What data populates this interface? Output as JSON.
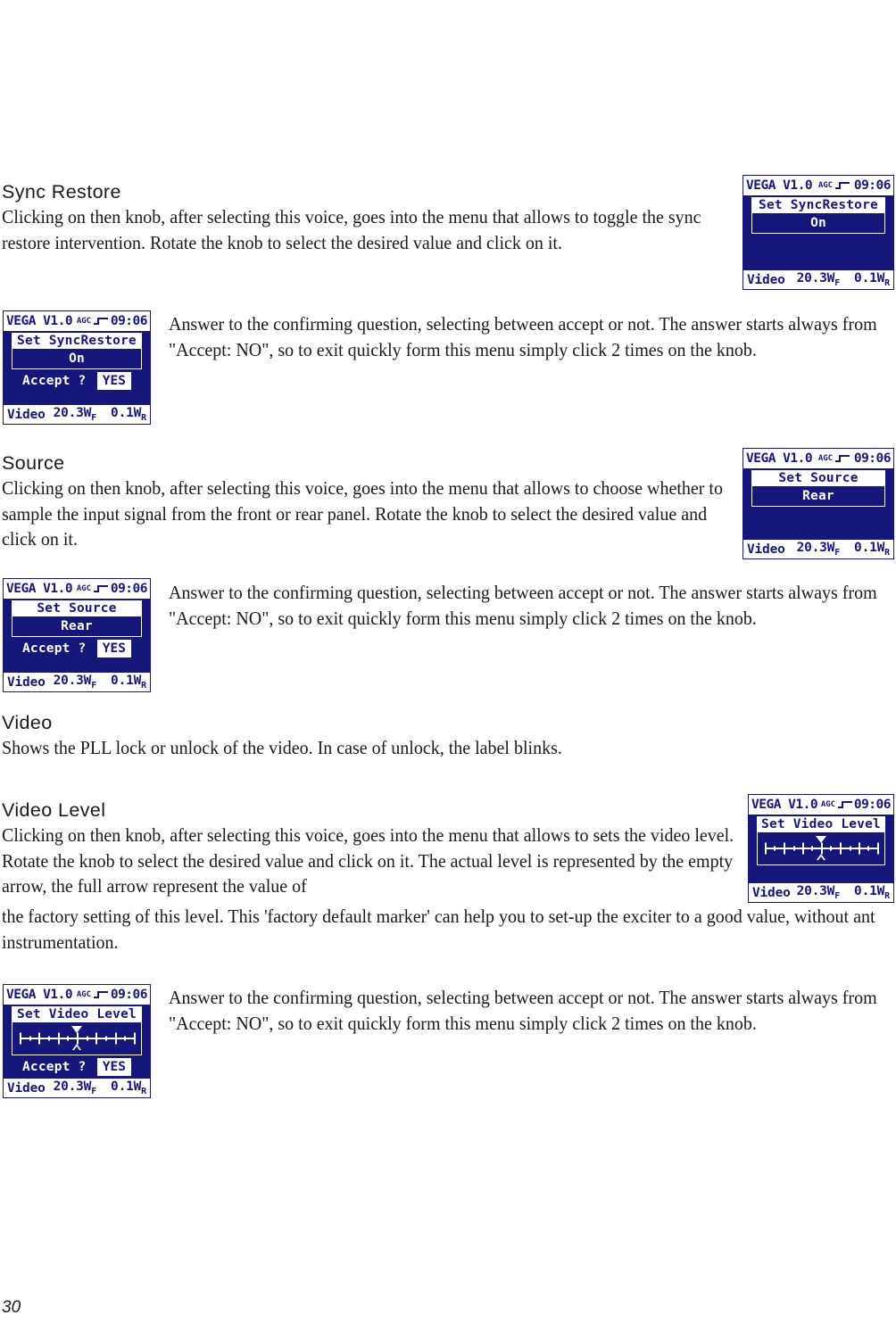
{
  "page": {
    "number": "30"
  },
  "sections": [
    {
      "heading": "Sync Restore",
      "body": "Clicking on then knob, after selecting this voice, goes into the menu that allows to toggle the sync restore intervention. Rotate the knob to select the desired value and click on it."
    },
    {
      "heading": "Source",
      "body": "Clicking on then knob, after selecting this voice, goes into the menu that allows to choose whether to sample the input signal from the front or rear panel. Rotate the knob to select the desired value and click on it."
    },
    {
      "heading": "Video",
      "body": "Shows the PLL lock or unlock of the video. In case of unlock, the label blinks."
    },
    {
      "heading": "Video Level",
      "body_narrow": "Clicking on then knob, after selecting this voice, goes into the menu that allows to sets the video level. Rotate the knob to select the desired value and click on it. The actual level is represented by the empty arrow, the full arrow represent the value of",
      "body_wide": "the factory setting of this level. This 'factory default marker' can help you to set-up the exciter to a good value, without ant instrumentation."
    }
  ],
  "confirm_paragraph": "Answer to the confirming question, selecting between accept or not. The answer starts always from \"Accept: NO\", so to exit quickly form this menu simply click 2 times on the knob.",
  "lcd_common": {
    "model": "VEGA V1.0",
    "agc_label": "AGC",
    "agc_icon": "square-step-icon",
    "time": "09:06",
    "status_label": "Video",
    "status_forward": "20.3W",
    "status_forward_sub": "F",
    "status_reverse": "0.1W",
    "status_reverse_sub": "R",
    "accept_label": "Accept ?",
    "accept_value": "YES",
    "colors": {
      "lcd_background": "#16177a",
      "lcd_foreground": "#ffffff"
    }
  },
  "lcd_panels": [
    {
      "id": "sync-restore-menu",
      "menu_title": "Set SyncRestore",
      "menu_value": "On",
      "has_accept": false,
      "has_slider": false
    },
    {
      "id": "sync-restore-confirm",
      "menu_title": "Set SyncRestore",
      "menu_value": "On",
      "has_accept": true,
      "has_slider": false
    },
    {
      "id": "source-menu",
      "menu_title": "Set Source",
      "menu_value": "Rear",
      "has_accept": false,
      "has_slider": false
    },
    {
      "id": "source-confirm",
      "menu_title": "Set Source",
      "menu_value": "Rear",
      "has_accept": true,
      "has_slider": false
    },
    {
      "id": "video-level-menu",
      "menu_title": "Set Video Level",
      "menu_value": "",
      "has_accept": false,
      "has_slider": true
    },
    {
      "id": "video-level-confirm",
      "menu_title": "Set Video Level",
      "menu_value": "",
      "has_accept": true,
      "has_slider": true
    }
  ],
  "slider": {
    "current_marker_pct": 50,
    "factory_marker_pct": 50,
    "major_ticks_pct": [
      0,
      16.6,
      33.3,
      50,
      66.6,
      83.3,
      100
    ],
    "minor_ticks_pct": [
      8.3,
      25,
      41.6,
      58.3,
      75,
      91.6
    ]
  }
}
